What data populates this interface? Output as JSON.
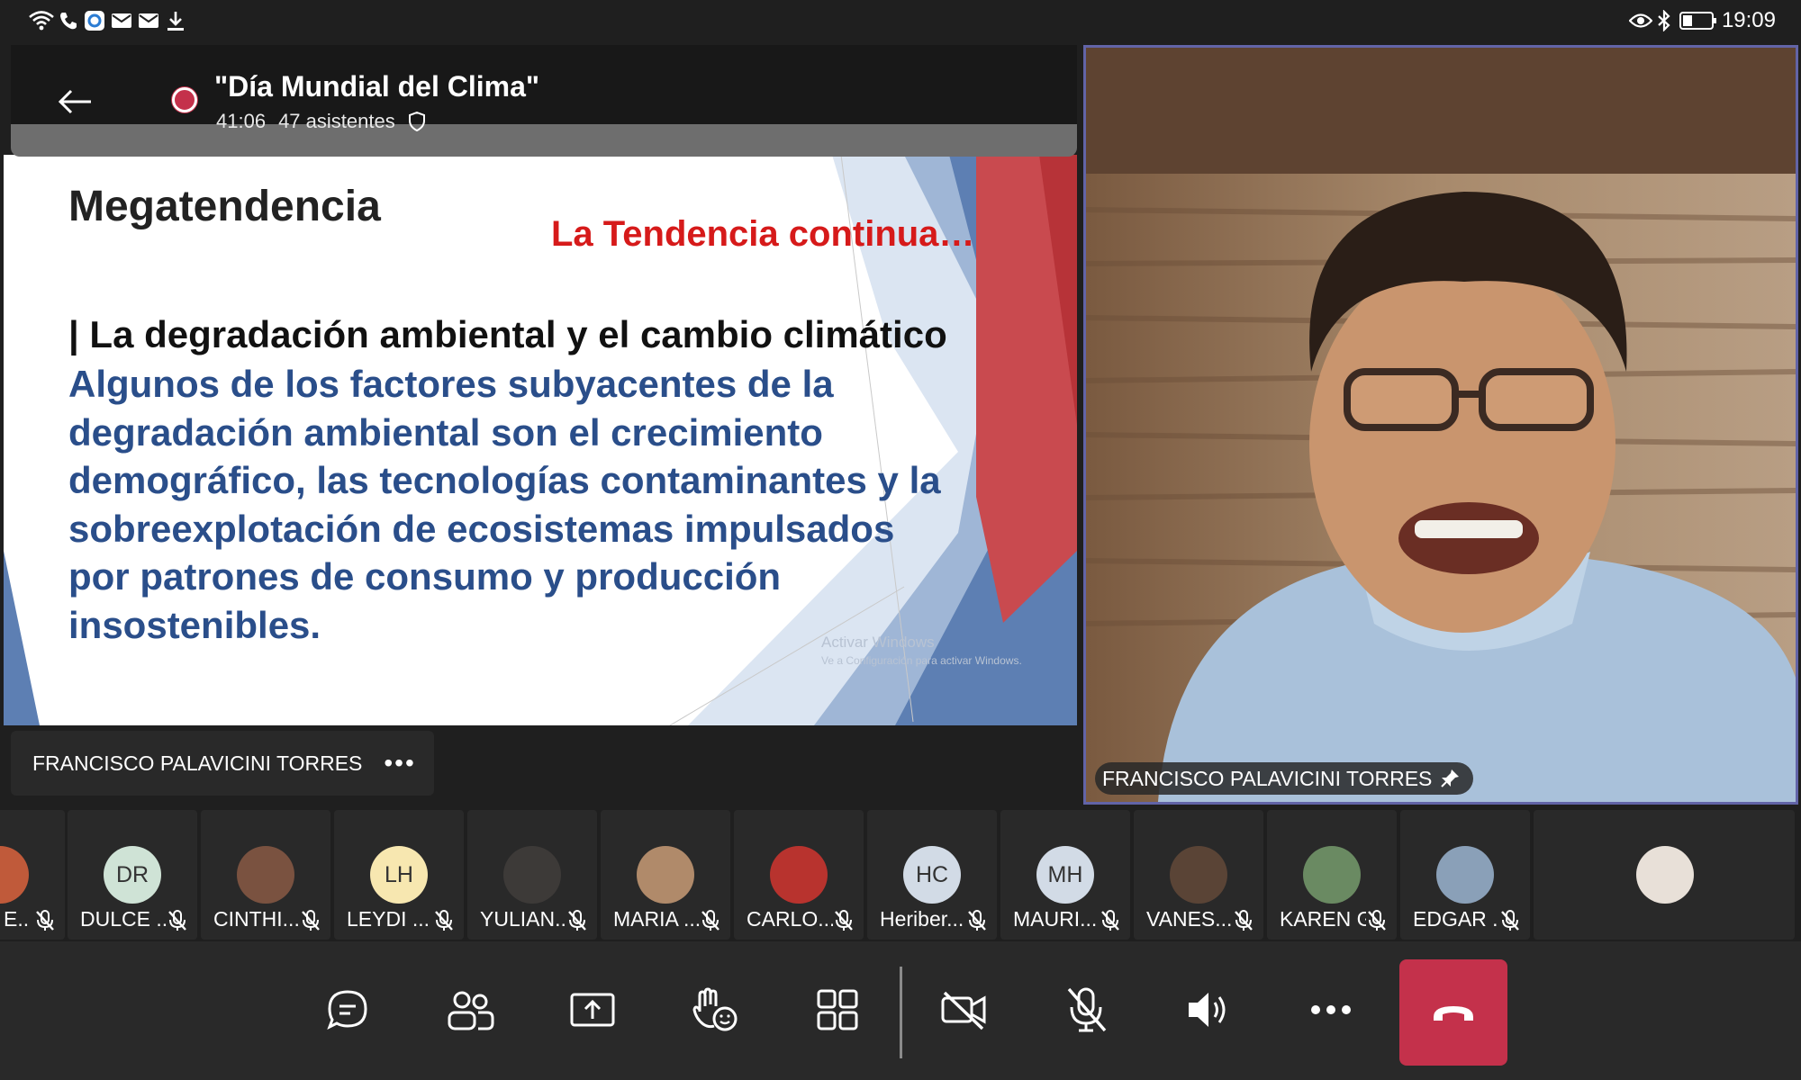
{
  "status_bar": {
    "time": "19:09",
    "left_icons": [
      "wifi-icon",
      "phone-icon",
      "app-icon",
      "mail-icon",
      "mail-icon",
      "download-icon"
    ],
    "right_icons": [
      "eye-icon",
      "bluetooth-icon",
      "battery-icon"
    ]
  },
  "meeting": {
    "title": "\"Día Mundial del Clima\"",
    "duration": "41:06",
    "attendees": "47 asistentes"
  },
  "slide": {
    "heading": "Megatendencia",
    "red_subtitle": "La Tendencia continua…",
    "subheading": "| La degradación ambiental y el cambio climático",
    "body_lines": [
      "Algunos de los factores subyacentes de la",
      "degradación ambiental son el crecimiento",
      "demográfico, las tecnologías contaminantes y la",
      "sobreexplotación de ecosistemas impulsados",
      "por patrones de consumo y producción",
      "insostenibles."
    ],
    "watermark_line1": "Activar Windows",
    "watermark_line2": "Ve a Configuración para activar Windows."
  },
  "presenter": {
    "name": "FRANCISCO PALAVICINI TORRES",
    "more": "•••"
  },
  "video": {
    "name": "FRANCISCO PALAVICINI TORRES"
  },
  "participants": [
    {
      "name": "E...",
      "initials": "",
      "photo": true
    },
    {
      "name": "DULCE ...",
      "initials": "DR",
      "color": "#cfe3d6"
    },
    {
      "name": "CINTHI...",
      "initials": "",
      "photo": true
    },
    {
      "name": "LEYDI ...",
      "initials": "LH",
      "color": "#f7e7b0"
    },
    {
      "name": "YULIAN...",
      "initials": "",
      "photo": true
    },
    {
      "name": "MARIA ...",
      "initials": "",
      "photo": true
    },
    {
      "name": "CARLO...",
      "initials": "",
      "photo": true
    },
    {
      "name": "Heriber...",
      "initials": "HC",
      "color": "#d2dbe6"
    },
    {
      "name": "MAURI...",
      "initials": "MH",
      "color": "#d2dbe6"
    },
    {
      "name": "VANES...",
      "initials": "",
      "photo": true
    },
    {
      "name": "KAREN G",
      "initials": "",
      "photo": true
    },
    {
      "name": "EDGAR ...",
      "initials": "",
      "photo": true
    },
    {
      "name": "",
      "initials": "",
      "photo": true
    }
  ],
  "controls": {
    "items": [
      "chat-icon",
      "participants-icon",
      "share-icon",
      "raise-hand-icon",
      "layout-icon",
      "camera-off-icon",
      "mic-off-icon",
      "speaker-icon",
      "more-icon",
      "hangup-icon"
    ]
  },
  "colors": {
    "accent": "#6264a7",
    "hangup": "#c4314b",
    "slide_red": "#d61a1a",
    "slide_blue": "#2a4e8a"
  }
}
